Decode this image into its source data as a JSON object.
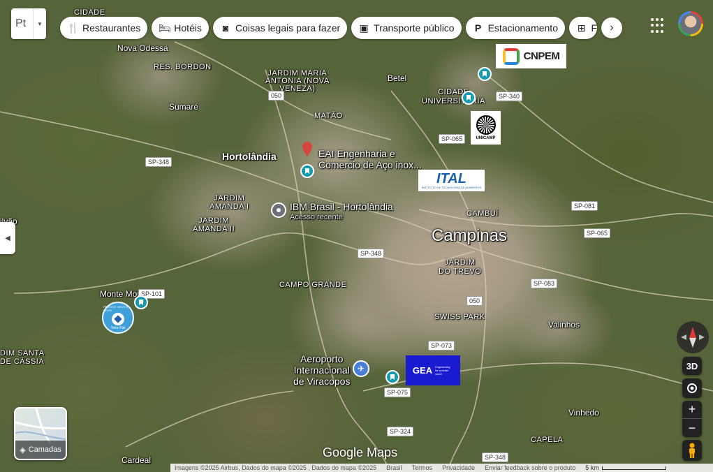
{
  "toolbar": {
    "language_button": "Pt",
    "chips": [
      {
        "label": "Restaurantes",
        "icon": "fork-knife-icon"
      },
      {
        "label": "Hotéis",
        "icon": "bed-icon"
      },
      {
        "label": "Coisas legais para fazer",
        "icon": "camera-icon"
      },
      {
        "label": "Transporte público",
        "icon": "train-icon"
      },
      {
        "label": "Estacionamento",
        "icon": "parking-icon"
      },
      {
        "label": "F",
        "icon": "pharmacy-icon"
      }
    ]
  },
  "map": {
    "cities": {
      "campinas": "Campinas",
      "hortolandia": "Hortolândia",
      "sumare": "Sumaré",
      "valinhos": "Valinhos",
      "vinhedo": "Vinhedo",
      "monte_mor": "Monte Mor",
      "cardeal": "Cardeal",
      "nova_odessa": "Nova Odessa",
      "betel": "Betel"
    },
    "neighborhoods": {
      "cidade": "CIDADE",
      "res_bordon": "RES. BORDON",
      "jardim_maria_antonia": "JARDIM MARIA\nANTONIA (NOVA\nVENEZA)",
      "matao": "MATÃO",
      "cidade_universitaria": "CIDADE\nUNIVERSITÁRIA",
      "jardim_amanda_i": "JARDIM\nAMANDA I",
      "jardim_amanda_ii": "JARDIM\nAMANDA II",
      "cambui": "CAMBUÍ",
      "jardim_do_trevo": "JARDIM\nDO TREVO",
      "campo_grande": "CAMPO GRANDE",
      "swiss_park": "SWISS PARK",
      "capela": "CAPELA",
      "santa_de_cassia": "DIM SANTA\nDE CÁSSIA",
      "ilvao": "ilvão"
    },
    "roads": [
      "SP-348",
      "SP-340",
      "SP-065",
      "SP-081",
      "SP-065",
      "SP-348",
      "SP-101",
      "050",
      "050",
      "SP-083",
      "SP-073",
      "SP-075",
      "SP-324",
      "SP-348"
    ],
    "pois": {
      "eai": "EAI Engenharia e\nComercio de Aço inox...",
      "ibm": "IBM Brasil - Hortolândia",
      "ibm_sub": "Acesso recente",
      "airport": "Aeroporto\nInternacional\nde Viracopos"
    },
    "logos": {
      "cnpem": "CNPEM",
      "unicamp": "UNICAMP",
      "ital": "ITAL",
      "ital_sub": "INSTITUTO DE TECNOLOGIA DE ALIMENTOS",
      "gea": "GEA",
      "gea_sub": "Engineering for a better world",
      "tetrapak": "Tetra Pak",
      "tetrapak_ring": "PROTECT WHAT'S GOOD"
    }
  },
  "controls": {
    "layers_label": "Camadas",
    "view_3d": "3D",
    "zoom_in": "+",
    "zoom_out": "−"
  },
  "branding": "Google Maps",
  "footer": {
    "imagery": "Imagens ©2025 Airbus, Dados do mapa ©2025 , Dados do mapa ©2025",
    "country": "Brasil",
    "terms": "Termos",
    "privacy": "Privacidade",
    "feedback": "Enviar feedback sobre o produto",
    "scale": "5 km"
  },
  "colors": {
    "pin_red": "#e53935",
    "bookmark_teal": "#159ab0",
    "gea_blue": "#1a1ad0"
  }
}
